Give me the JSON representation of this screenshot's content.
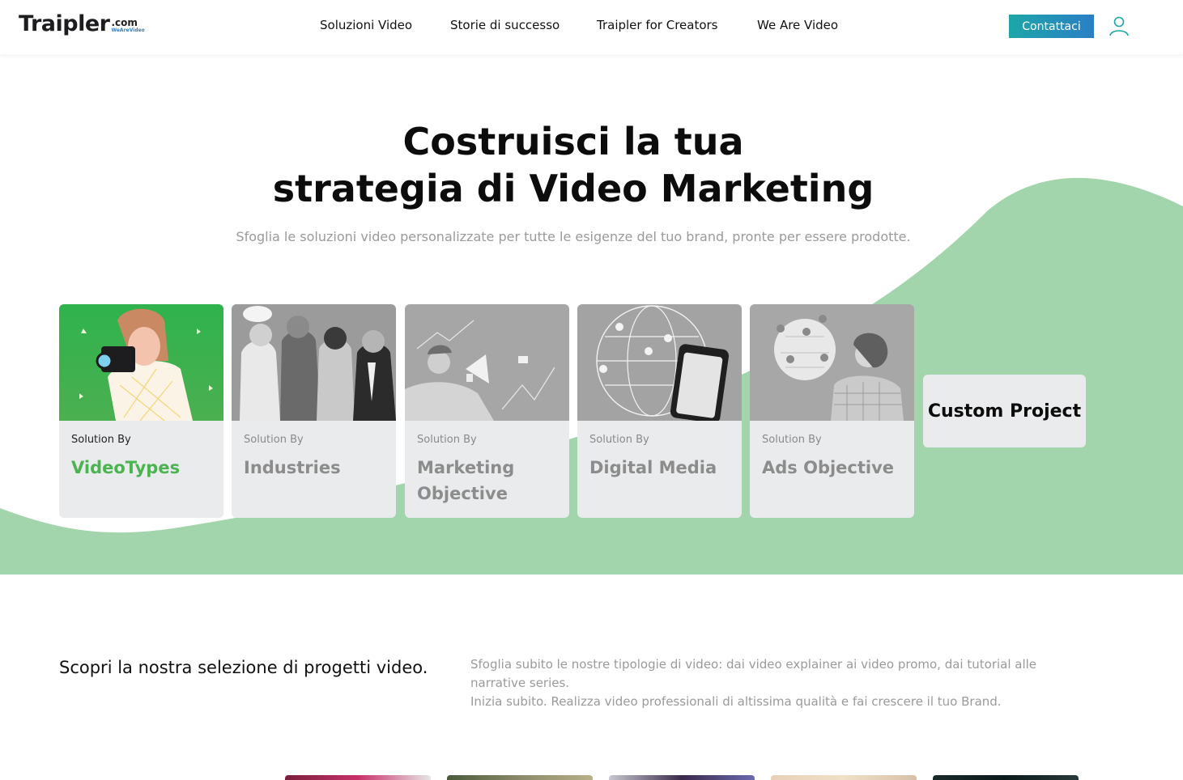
{
  "header": {
    "logo": {
      "main": "Traipler",
      "com": ".com",
      "tag": "WeAreVideo"
    },
    "nav": [
      {
        "label": "Soluzioni Video"
      },
      {
        "label": "Storie di successo"
      },
      {
        "label": "Traipler for Creators"
      },
      {
        "label": "We Are Video"
      }
    ],
    "contact_label": "Contattaci",
    "user_icon": "user-icon"
  },
  "hero": {
    "title_line1": "Costruisci la tua",
    "title_line2": "strategia di Video Marketing",
    "subtitle": "Sfoglia le soluzioni video personalizzate per tutte le esigenze del tuo brand, pronte per essere prodotte."
  },
  "cards": [
    {
      "small": "Solution By",
      "big": "VideoTypes",
      "active": true
    },
    {
      "small": "Solution By",
      "big": "Industries",
      "active": false
    },
    {
      "small": "Solution By",
      "big": "Marketing Objective",
      "active": false
    },
    {
      "small": "Solution By",
      "big": "Digital Media",
      "active": false
    },
    {
      "small": "Solution By",
      "big": "Ads Objective",
      "active": false
    }
  ],
  "custom_project": "Custom Project",
  "selection": {
    "title": "Scopri la nostra selezione di progetti video.",
    "desc_line1": "Sfoglia subito le nostre tipologie di video: dai video explainer ai video promo, dai tutorial alle narrative series.",
    "desc_line2": "Inizia subito. Realizza video professionali di altissima qualità e fai crescere il tuo Brand."
  },
  "colors": {
    "accent_green": "#4bb34f",
    "hero_wave": "#a2d5ac",
    "button_gradient_start": "#1da6a8",
    "button_gradient_end": "#2a7fc6"
  }
}
